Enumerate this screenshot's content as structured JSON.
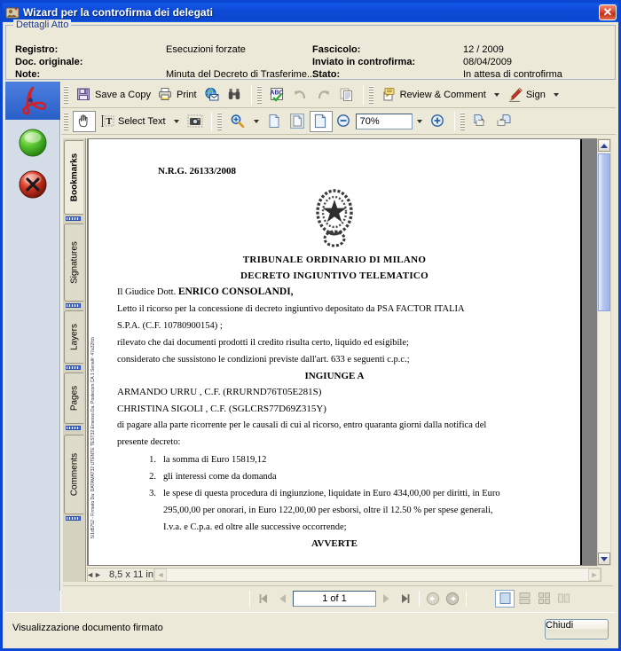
{
  "window": {
    "title": "Wizard per la controfirma dei delegati",
    "close_label": "✕",
    "icon": "wizard-app-icon"
  },
  "details": {
    "legend": "Dettagli Atto",
    "rows": [
      {
        "label": "Registro:",
        "value": "Esecuzioni forzate"
      },
      {
        "label": "Doc. originale:",
        "value": ""
      },
      {
        "label": "Note:",
        "value": "Minuta del Decreto di Trasferime..."
      }
    ],
    "rows_right": [
      {
        "label": "Fascicolo:",
        "value": "12 / 2009"
      },
      {
        "label": "Inviato in controfirma:",
        "value": "08/04/2009"
      },
      {
        "label": "Stato:",
        "value": "In attesa di controfirma"
      }
    ]
  },
  "strip": {
    "items": [
      {
        "name": "acrobat-icon",
        "selected": true
      },
      {
        "name": "green-ok-icon",
        "selected": false
      },
      {
        "name": "red-cancel-icon",
        "selected": false
      }
    ]
  },
  "toolbar1": {
    "save_label": "Save a Copy",
    "print_label": "Print",
    "email_label": "",
    "search_label": "",
    "spelling_label": "",
    "undo_label": "",
    "redo_label": "",
    "copy_label": "",
    "review_label": "Review & Comment",
    "sign_label": "Sign"
  },
  "toolbar2": {
    "hand_label": "",
    "select_text_label": "Select Text",
    "snapshot_label": "",
    "zoom_label": "",
    "actual_size_label": "",
    "fit_page_label": "",
    "fit_width_label": "",
    "zoom_out_label": "",
    "zoom_value": "70%",
    "zoom_in_label": "",
    "prev_view_label": "",
    "next_view_label": ""
  },
  "tabs": [
    {
      "label": "Bookmarks",
      "selected": true
    },
    {
      "label": "Signatures",
      "selected": false
    },
    {
      "label": "Layers",
      "selected": false
    },
    {
      "label": "Pages",
      "selected": false
    },
    {
      "label": "Comments",
      "selected": false
    }
  ],
  "document": {
    "nrg": "N.R.G. 26133/2008",
    "emblem": "italian-republic-emblem",
    "heading1": "TRIBUNALE ORDINARIO DI MILANO",
    "heading2": "DECRETO INGIUNTIVO TELEMATICO",
    "line_judge_prefix": "Il Giudice Dott.",
    "line_judge_name": "ENRICO CONSOLANDI,",
    "line1": "Letto il ricorso per la concessione di decreto ingiuntivo depositato da  PSA FACTOR ITALIA",
    "line2": "S.P.A. (C.F. 10780900154) ;",
    "line3": "rilevato che dai documenti prodotti il credito risulta certo, liquido ed esigibile;",
    "line4": "considerato che sussistono le condizioni previste dall'art. 633 e seguenti c.p.c.;",
    "heading3": "INGIUNGE A",
    "party1": "ARMANDO  URRU , C.F. (RRURND76T05E281S)",
    "party2": "CHRISTINA  SIGOLI , C.F. (SGLCRS77D69Z315Y)",
    "line5": "di pagare alla parte ricorrente per le causali di cui al ricorso, entro quaranta giorni dalla notifica del",
    "line6": "presente decreto:",
    "items": [
      {
        "n": "1.",
        "text": "la somma di Euro 15819,12"
      },
      {
        "n": "2.",
        "text": "gli  interessi come da domanda"
      },
      {
        "n": "3.",
        "text": "le spese di questa procedura di ingiunzione, liquidate in Euro 434,00,00 per diritti, in Euro"
      }
    ],
    "item3_line2": "295,00,00 per onorari, in Euro 122,00,00 per esborsi, oltre il 12.50 % per spese generali,",
    "item3_line3": "I.v.a. e C.p.a. ed oltre alle successive occorrende;",
    "heading4": "AVVERTE",
    "signature_stamp": "5/1d5752 - Firmato Da: DATAMAT32 UTENTE TEST32 Emesso Da: Postecom CA 1 Serial#: 47a32fcb"
  },
  "pagesize": "8,5 x 11 in",
  "nav": {
    "first_label": "",
    "prev_label": "",
    "page_value": "1 of 1",
    "next_label": "",
    "last_label": "",
    "prev_view_label": "",
    "next_view_label": "",
    "layout_single": "single-page-layout",
    "layout_continuous": "continuous-layout",
    "layout_facing": "facing-layout",
    "layout_continuous_facing": "continuous-facing-layout"
  },
  "status": {
    "text": "Visualizzazione documento firmato",
    "close_button": "Chiudi"
  },
  "colors": {
    "title_bar": "#0a46d2",
    "window_bg": "#ece9d8",
    "accent": "#1a3a8f"
  }
}
